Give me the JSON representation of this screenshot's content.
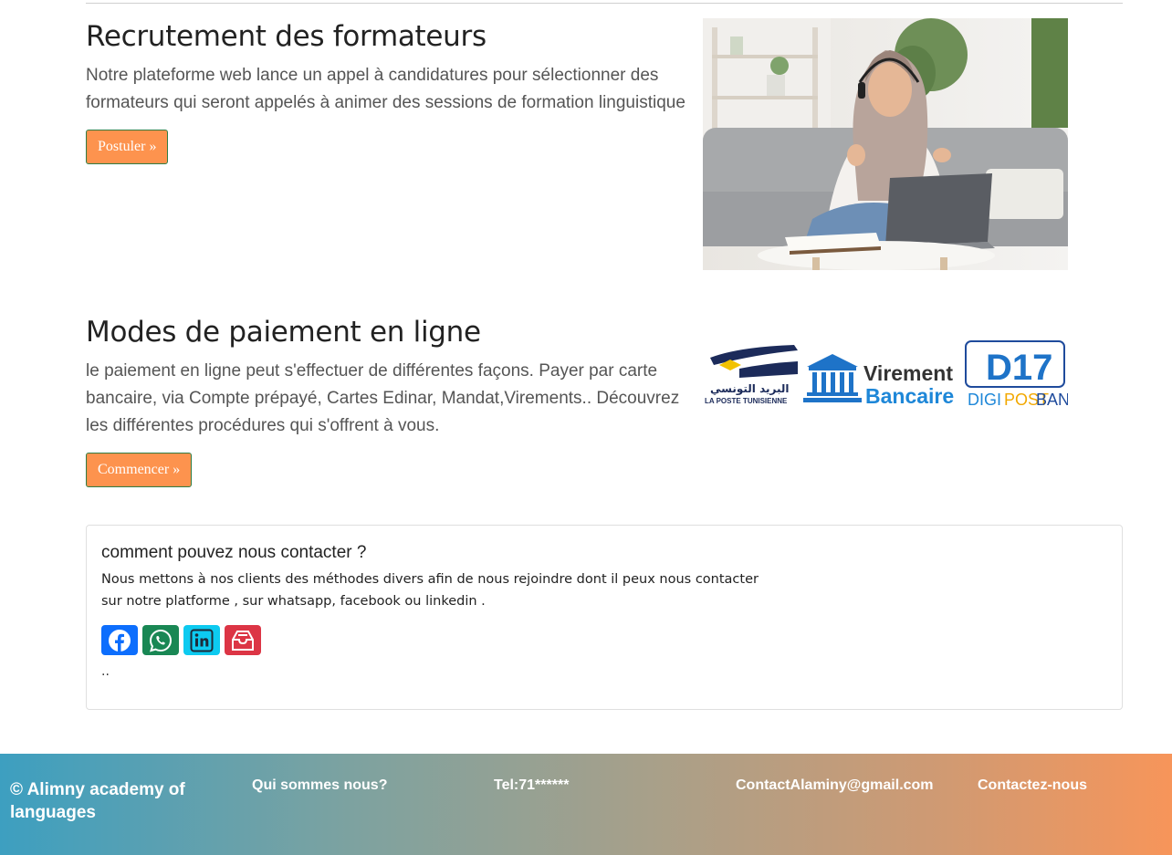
{
  "recruitment": {
    "title": "Recrutement des formateurs",
    "text": "Notre plateforme web lance un appel à candidatures pour sélectionner des formateurs qui seront appelés à animer des sessions de formation linguistique",
    "button": "Postuler »"
  },
  "payment": {
    "title": "Modes de paiement en ligne",
    "text": "le paiement en ligne peut s'effectuer de différentes façons. Payer par carte bancaire, via Compte prépayé, Cartes Edinar, Mandat,Virements.. Découvrez les différentes procédures qui s'offrent à vous.",
    "button": "Commencer »",
    "logos": {
      "poste_ar": "البريد التونسي",
      "poste_fr": "LA POSTE TUNISIENNE",
      "virement": "Virement",
      "bancaire": "Bancaire",
      "d17": "D17",
      "digi": "DIGI",
      "post": "POST",
      "bank": "BANK"
    }
  },
  "contact": {
    "title": "comment pouvez nous contacter ?",
    "text": "Nous mettons à nos clients des méthodes divers afin de nous rejoindre dont il peux nous contacter sur notre platforme , sur whatsapp, facebook ou linkedin .",
    "footer_dots": "..",
    "socials": [
      {
        "icon": "facebook-icon",
        "color": "#0d6efd"
      },
      {
        "icon": "whatsapp-icon",
        "color": "#198754"
      },
      {
        "icon": "linkedin-icon",
        "color": "#0dcaf0"
      },
      {
        "icon": "inbox-icon",
        "color": "#dc3545"
      }
    ]
  },
  "footer": {
    "brand": "© Alimny academy of languages",
    "about": "Qui sommes nous?",
    "phone": "Tel:71******",
    "email": "ContactAlaminy@gmail.com",
    "contact": "Contactez-nous"
  }
}
